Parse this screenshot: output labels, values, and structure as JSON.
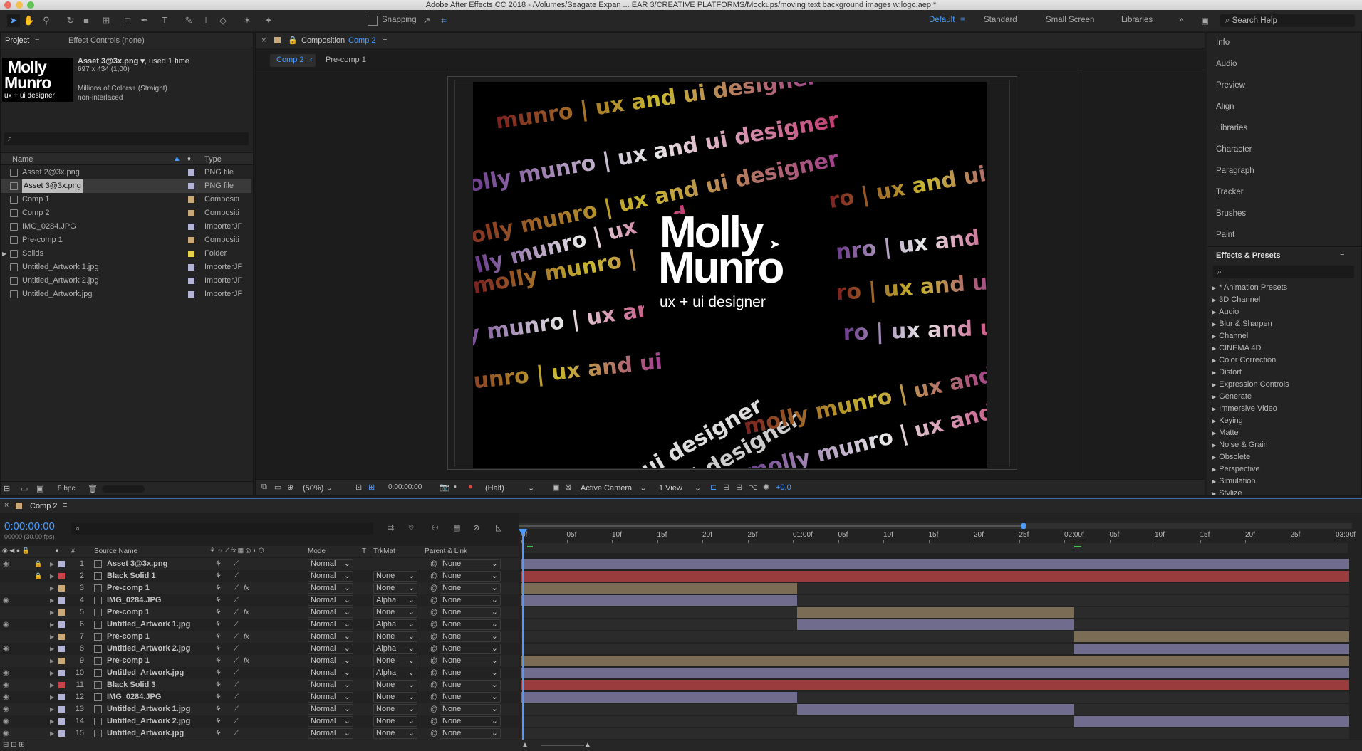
{
  "window": {
    "title": "Adobe After Effects CC 2018 - /Volumes/Seagate Expan ... EAR 3/CREATIVE PLATFORMS/Mockups/moving text background images w:logo.aep *"
  },
  "toolbar": {
    "snapping": "Snapping",
    "workspaces": [
      "Default",
      "Standard",
      "Small Screen",
      "Libraries"
    ],
    "search_help": "Search Help"
  },
  "project": {
    "tab_project": "Project",
    "tab_effects": "Effect Controls (none)",
    "asset_name": "Asset 3@3x.png ▾",
    "asset_used": ", used 1 time",
    "asset_dims": "697 x 434 (1,00)",
    "asset_colors": "Millions of Colors+ (Straight)",
    "asset_interlace": "non-interlaced",
    "thumb_line1": "Molly",
    "thumb_line2": "Munro",
    "thumb_line3": "ux + ui designer",
    "col_name": "Name",
    "col_type": "Type",
    "bpc": "8 bpc",
    "items": [
      {
        "name": "Asset 2@3x.png",
        "type": "PNG file",
        "color": "#b3b3d6"
      },
      {
        "name": "Asset 3@3x.png",
        "type": "PNG file",
        "color": "#b3b3d6"
      },
      {
        "name": "Comp 1",
        "type": "Compositi",
        "color": "#c9a97a"
      },
      {
        "name": "Comp 2",
        "type": "Compositi",
        "color": "#c9a97a"
      },
      {
        "name": "IMG_0284.JPG",
        "type": "ImporterJF",
        "color": "#b3b3d6"
      },
      {
        "name": "Pre-comp 1",
        "type": "Compositi",
        "color": "#c9a97a"
      },
      {
        "name": "Solids",
        "type": "Folder",
        "color": "#e8d14a"
      },
      {
        "name": "Untitled_Artwork 1.jpg",
        "type": "ImporterJF",
        "color": "#b3b3d6"
      },
      {
        "name": "Untitled_Artwork 2.jpg",
        "type": "ImporterJF",
        "color": "#b3b3d6"
      },
      {
        "name": "Untitled_Artwork.jpg",
        "type": "ImporterJF",
        "color": "#b3b3d6"
      }
    ]
  },
  "composition": {
    "tab_prefix": "Composition",
    "tab_name": "Comp 2",
    "crumb1": "Comp 2",
    "crumb2": "Pre-comp 1",
    "logo_line1": "Molly",
    "logo_line2": "Munro",
    "logo_line3": "ux + ui designer",
    "zoom": "(50%)",
    "timecode": "0:00:00:00",
    "resolution": "(Half)",
    "camera": "Active Camera",
    "view": "1 View",
    "exposure": "+0,0"
  },
  "right_panels": {
    "items": [
      "Info",
      "Audio",
      "Preview",
      "Align",
      "Libraries",
      "Character",
      "Paragraph",
      "Tracker",
      "Brushes",
      "Paint"
    ],
    "effects_title": "Effects & Presets",
    "effects": [
      "* Animation Presets",
      "3D Channel",
      "Audio",
      "Blur & Sharpen",
      "Channel",
      "CINEMA 4D",
      "Color Correction",
      "Distort",
      "Expression Controls",
      "Generate",
      "Immersive Video",
      "Keying",
      "Matte",
      "Noise & Grain",
      "Obsolete",
      "Perspective",
      "Simulation",
      "Stylize"
    ]
  },
  "timeline": {
    "tab": "Comp 2",
    "timecode": "0:00:00:00",
    "fps": "00000 (30.00 fps)",
    "col_source": "Source Name",
    "col_mode": "Mode",
    "col_t": "T",
    "col_trkmat": "TrkMat",
    "col_parent": "Parent & Link",
    "ruler": [
      "0f",
      "05f",
      "10f",
      "15f",
      "20f",
      "25f",
      "01:00f",
      "05f",
      "10f",
      "15f",
      "20f",
      "25f",
      "02:00f",
      "05f",
      "10f",
      "15f",
      "20f",
      "25f",
      "03:00f"
    ],
    "layers": [
      {
        "num": "1",
        "name": "Asset 3@3x.png",
        "color": "#b3b3d6",
        "mode": "Normal",
        "trkmat": "",
        "parent": "None",
        "fx": "",
        "eye": true
      },
      {
        "num": "2",
        "name": "Black Solid 1",
        "color": "#c9434a",
        "mode": "Normal",
        "trkmat": "None",
        "parent": "None",
        "fx": "",
        "eye": false
      },
      {
        "num": "3",
        "name": "Pre-comp 1",
        "color": "#c9a97a",
        "mode": "Normal",
        "trkmat": "None",
        "parent": "None",
        "fx": "fx",
        "eye": false
      },
      {
        "num": "4",
        "name": "IMG_0284.JPG",
        "color": "#b3b3d6",
        "mode": "Normal",
        "trkmat": "Alpha",
        "parent": "None",
        "fx": "",
        "eye": true
      },
      {
        "num": "5",
        "name": "Pre-comp 1",
        "color": "#c9a97a",
        "mode": "Normal",
        "trkmat": "None",
        "parent": "None",
        "fx": "fx",
        "eye": false
      },
      {
        "num": "6",
        "name": "Untitled_Artwork 1.jpg",
        "color": "#b3b3d6",
        "mode": "Normal",
        "trkmat": "Alpha",
        "parent": "None",
        "fx": "",
        "eye": true
      },
      {
        "num": "7",
        "name": "Pre-comp 1",
        "color": "#c9a97a",
        "mode": "Normal",
        "trkmat": "None",
        "parent": "None",
        "fx": "fx",
        "eye": false
      },
      {
        "num": "8",
        "name": "Untitled_Artwork 2.jpg",
        "color": "#b3b3d6",
        "mode": "Normal",
        "trkmat": "Alpha",
        "parent": "None",
        "fx": "",
        "eye": true
      },
      {
        "num": "9",
        "name": "Pre-comp 1",
        "color": "#c9a97a",
        "mode": "Normal",
        "trkmat": "None",
        "parent": "None",
        "fx": "fx",
        "eye": false
      },
      {
        "num": "10",
        "name": "Untitled_Artwork.jpg",
        "color": "#b3b3d6",
        "mode": "Normal",
        "trkmat": "Alpha",
        "parent": "None",
        "fx": "",
        "eye": true
      },
      {
        "num": "11",
        "name": "Black Solid 3",
        "color": "#c9434a",
        "mode": "Normal",
        "trkmat": "None",
        "parent": "None",
        "fx": "",
        "eye": true
      },
      {
        "num": "12",
        "name": "IMG_0284.JPG",
        "color": "#b3b3d6",
        "mode": "Normal",
        "trkmat": "None",
        "parent": "None",
        "fx": "",
        "eye": true
      },
      {
        "num": "13",
        "name": "Untitled_Artwork 1.jpg",
        "color": "#b3b3d6",
        "mode": "Normal",
        "trkmat": "None",
        "parent": "None",
        "fx": "",
        "eye": true
      },
      {
        "num": "14",
        "name": "Untitled_Artwork 2.jpg",
        "color": "#b3b3d6",
        "mode": "Normal",
        "trkmat": "None",
        "parent": "None",
        "fx": "",
        "eye": true
      },
      {
        "num": "15",
        "name": "Untitled_Artwork.jpg",
        "color": "#b3b3d6",
        "mode": "Normal",
        "trkmat": "None",
        "parent": "None",
        "fx": "",
        "eye": true
      }
    ]
  }
}
